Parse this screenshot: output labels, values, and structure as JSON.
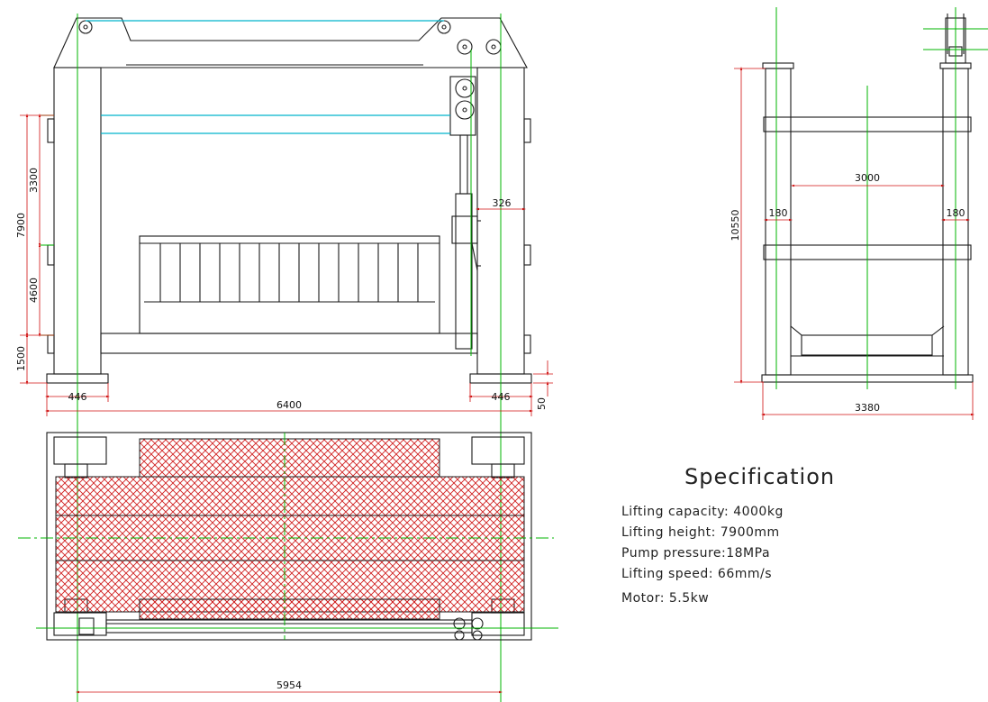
{
  "dimensions": {
    "front_height_total": "7900",
    "front_upper": "3300",
    "front_lower": "4600",
    "front_base": "1500",
    "front_width": "6400",
    "front_col_left": "446",
    "front_col_right": "446",
    "front_offset": "326",
    "front_foot": "50",
    "side_height": "10550",
    "side_inner": "3000",
    "side_left": "180",
    "side_right": "180",
    "side_width": "3380",
    "plan_width": "5954"
  },
  "specification": {
    "title": "Specification",
    "items": [
      {
        "label": "Lifting capacity: 4000kg"
      },
      {
        "label": "Lifting height: 7900mm"
      },
      {
        "label": "Pump pressure:18MPa"
      },
      {
        "label": "Lifting speed: 66mm/s"
      },
      {
        "label": "Motor: 5.5kw"
      }
    ]
  },
  "colors": {
    "line": "#1a1a1a",
    "dimension": "#d01010",
    "centerline": "#00b400",
    "cable": "#00b4cc",
    "hatch": "#d02020"
  }
}
